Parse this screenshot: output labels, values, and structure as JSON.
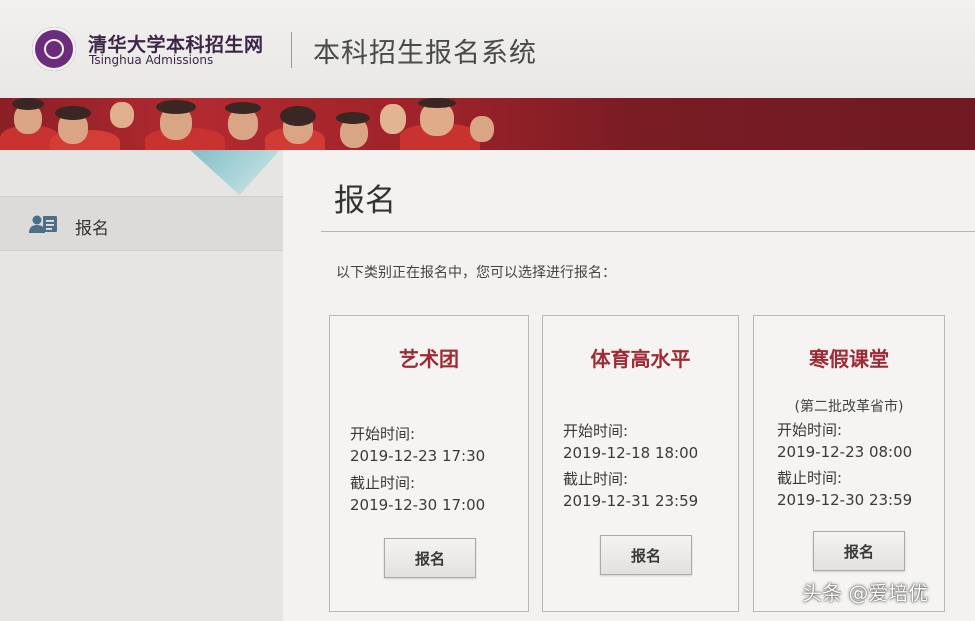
{
  "header": {
    "logo_cn": "清华大学本科招生网",
    "logo_en": "Tsinghua Admissions",
    "system_title": "本科招生报名系统"
  },
  "sidebar": {
    "items": [
      {
        "label": "报名",
        "icon": "user-form-icon"
      }
    ]
  },
  "main": {
    "page_title": "报名",
    "intro": "以下类别正在报名中，您可以选择进行报名：",
    "cards": [
      {
        "title": "艺术团",
        "subtitle": "",
        "start_label": "开始时间:",
        "start_time": "2019-12-23 17:30",
        "end_label": "截止时间:",
        "end_time": "2019-12-30 17:00",
        "button_label": "报名"
      },
      {
        "title": "体育高水平",
        "subtitle": "",
        "start_label": "开始时间:",
        "start_time": "2019-12-18 18:00",
        "end_label": "截止时间:",
        "end_time": "2019-12-31 23:59",
        "button_label": "报名"
      },
      {
        "title": "寒假课堂",
        "subtitle": "(第二批改革省市)",
        "start_label": "开始时间:",
        "start_time": "2019-12-23 08:00",
        "end_label": "截止时间:",
        "end_time": "2019-12-30 23:59",
        "button_label": "报名"
      }
    ]
  },
  "watermark": "头条 @爱培优",
  "colors": {
    "accent_red": "#9e2a35",
    "banner_red": "#9d2229",
    "logo_purple": "#6a2c7b"
  }
}
